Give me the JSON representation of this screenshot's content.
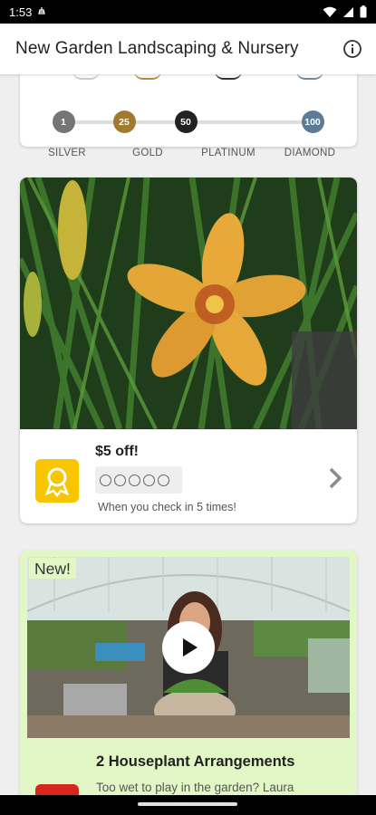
{
  "status_bar": {
    "time": "1:53",
    "icons": [
      "notification-icon",
      "wifi-icon",
      "cellular-icon",
      "battery-icon"
    ]
  },
  "app_bar": {
    "title": "New Garden Landscaping & Nursery",
    "info_icon": "info-icon"
  },
  "tiers": {
    "labels": [
      "SILVER",
      "GOLD",
      "PLATINUM",
      "DIAMOND"
    ],
    "milestones": [
      {
        "value": "1",
        "color": "#757575"
      },
      {
        "value": "25",
        "color": "#a07a2e"
      },
      {
        "value": "50",
        "color": "#222222"
      },
      {
        "value": "100",
        "color": "#5b7b96"
      }
    ]
  },
  "offer": {
    "title": "$5 off!",
    "punches_total": 5,
    "punches_done": 0,
    "subtitle": "When you check in 5 times!",
    "badge_color": "#f7c600",
    "chevron_icon": "chevron-right-icon"
  },
  "video_card": {
    "tag": "New!",
    "title": "2 Houseplant Arrangements",
    "description": "Too wet to play in the garden? Laura",
    "background": "#e2f7c6",
    "play_icon": "play-icon"
  }
}
